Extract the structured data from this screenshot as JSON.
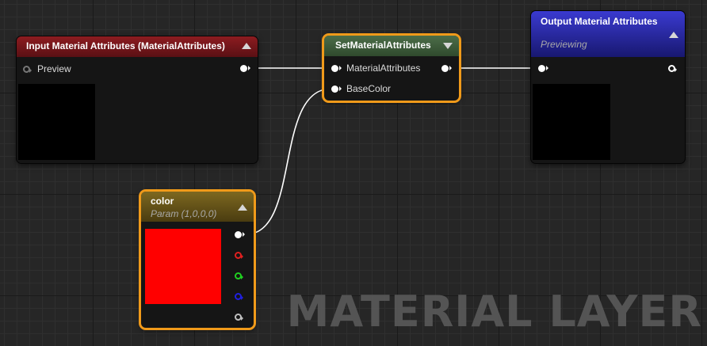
{
  "nodes": {
    "input": {
      "title": "Input Material Attributes (MaterialAttributes)",
      "pin_label": "Preview",
      "header_color": "#7a1518"
    },
    "set": {
      "title": "SetMaterialAttributes",
      "pins": [
        "MaterialAttributes",
        "BaseColor"
      ],
      "header_color": "#3c5a3a"
    },
    "output": {
      "title": "Output Material Attributes",
      "subtitle": "Previewing",
      "header_color": "#2a2a9a"
    },
    "color": {
      "title": "color",
      "subtitle": "Param (1,0,0,0)",
      "swatch_color": "#ff0000",
      "header_color": "#6e5a18",
      "channel_colors": [
        "#ffffff",
        "#e02020",
        "#20d020",
        "#2020e0",
        "#c0c0c0"
      ]
    }
  },
  "watermark": "MATERIAL LAYER"
}
